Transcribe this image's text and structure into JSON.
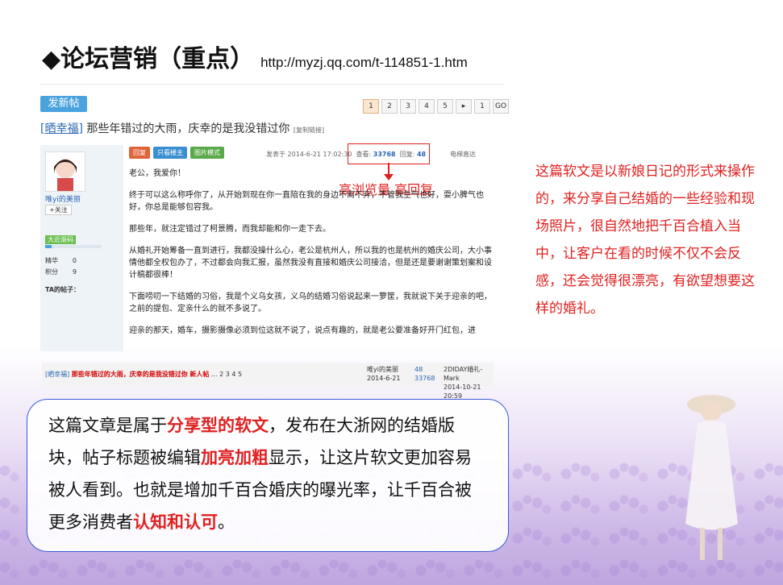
{
  "title": {
    "main": "◆论坛营销（重点）",
    "url": "http://myzj.qq.com/t-114851-1.htm"
  },
  "forum": {
    "new_post": "发新帖",
    "pager": [
      "1",
      "2",
      "3",
      "4",
      "5",
      "▸",
      "1",
      "GO"
    ],
    "thread_tag": "[晒幸福]",
    "thread_title": "那些年错过的大雨，庆幸的是我没错过你",
    "thread_copy": "[复制链接]",
    "user": {
      "name": "唯yi的美丽",
      "follow": "+关注",
      "level": "大近渐码",
      "stat1_label": "精华",
      "stat1_value": "0",
      "stat2_label": "积分",
      "stat2_value": "9",
      "posts_heading": "TA的帖子："
    },
    "buttons": {
      "reply": "回复",
      "only_author": "只看楼主",
      "gallery": "图片模式"
    },
    "meta": {
      "posted": "发表于 2014-6-21 17:02:30",
      "views_label": "查看:",
      "views": "33768",
      "replies_label": "回复:",
      "replies": "48"
    },
    "jump_label": "电梯直达",
    "annotation": "高浏览量 高回复",
    "post_lines": [
      "老公，我爱你！",
      "终于可以这么称呼你了，从开始到现在你一直陪在我的身边不离不弃，不管我生气也好，耍小脾气也好，你总是能够包容我。",
      "那些年，就注定错过了柯景腾，而我却能和你一走下去。",
      "从婚礼开始筹备一直到进行，我都没操什么心，老公是杭州人，所以我的也是杭州的婚庆公司，大小事情他都全权包办了，不过都会向我汇报，虽然我没有直接和婚庆公司接洽，但是还是要谢谢策划案和设计稿都很棒！",
      "下面唠叨一下结婚的习俗，我是个义乌女孩，义乌的结婚习俗说起来一箩筐，我就说下关于迎亲的吧，之前的提包、定亲什么的就不多说了。",
      "迎亲的那天，婚车，摄影摄像必须到位这就不说了，说点有趣的，就是老公要准备好开门红包，进"
    ]
  },
  "listing": {
    "tag": "[晒幸福]",
    "title": "那些年错过的大雨，庆幸的是我没错过你",
    "badge": "新人帖",
    "pages": "... 2 3 4 5",
    "author": "唯yi的美丽",
    "date": "2014-6-21",
    "replies": "48",
    "views": "33768",
    "last": "2DIDAY婚礼-Mark",
    "last_date": "2014-10-21 20:59"
  },
  "side_text": "这篇软文是以新娘日记的形式来操作的，来分享自己结婚的一些经验和现场照片，很自然地把千百合植入当中，让客户在看的时候不仅不会反感，还会觉得很漂亮，有欲望想要这样的婚礼。",
  "callout": {
    "p1": "这篇文章是属于",
    "h1": "分享型的软文",
    "p2": "，发布在大浙网的结婚版块，帖子标题被编辑",
    "h2": "加亮加粗",
    "p3": "显示，让这片软文更加容易被人看到。也就是增加千百合婚庆的曝光率，让千百合被更多消费者",
    "h3": "认知和认可",
    "p4": "。"
  },
  "colors": {
    "accent_red": "#e02020",
    "link_blue": "#2a66b5",
    "callout_border": "#3b5bd6"
  }
}
